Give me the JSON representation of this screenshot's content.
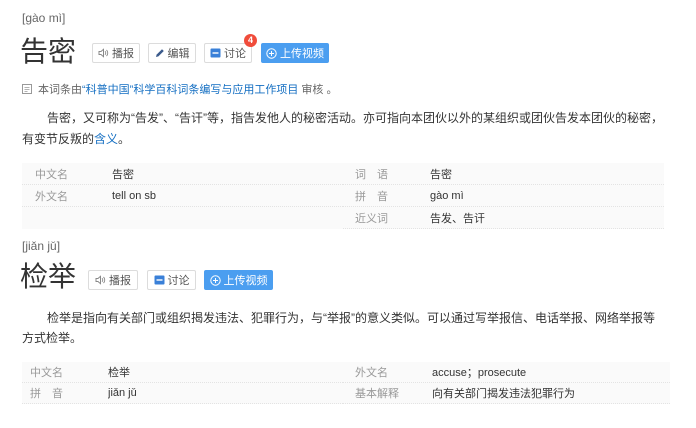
{
  "entries": [
    {
      "pinyin": "[gào mì]",
      "title": "告密",
      "actions": {
        "broadcast_label": "播报",
        "edit_label": "编辑",
        "discuss_label": "讨论",
        "discuss_count": "4",
        "upload_video_label": "上传视频"
      },
      "review_notice": {
        "prefix": "本词条由",
        "link": "“科普中国”科学百科词条编写与应用工作项目",
        "suffix": " 审核 。"
      },
      "summary": {
        "text_before_link": "告密，又可称为“告发”、“告讦”等，指告发他人的秘密活动。亦可指向本团伙以外的某组织或团伙告发本团伙的秘密，有变节反叛的",
        "link": "含义",
        "text_after_link": "。"
      },
      "basic_info": {
        "left": [
          {
            "label": "中文名",
            "value": "告密"
          },
          {
            "label": "外文名",
            "value": "tell on sb"
          }
        ],
        "right": [
          {
            "label": "词　语",
            "value": "告密"
          },
          {
            "label": "拼　音",
            "value": "gào mì"
          },
          {
            "label": "近义词",
            "value": "告发、告讦"
          }
        ]
      }
    },
    {
      "pinyin": "[jiǎn jǔ]",
      "title": "检举",
      "actions": {
        "broadcast_label": "播报",
        "discuss_label": "讨论",
        "upload_video_label": "上传视频"
      },
      "summary": {
        "text": "检举是指向有关部门或组织揭发违法、犯罪行为，与“举报”的意义类似。可以通过写举报信、电话举报、网络举报等方式检举。"
      },
      "basic_info": {
        "left": [
          {
            "label": "中文名",
            "value": "检举"
          },
          {
            "label": "拼　音",
            "value": "jiǎn jǔ"
          }
        ],
        "right": [
          {
            "label": "外文名",
            "value": "accuse；prosecute"
          },
          {
            "label": "基本解释",
            "value": "向有关部门揭发违法犯罪行为"
          }
        ]
      }
    }
  ],
  "icons": {
    "broadcast": "speaker-icon",
    "edit": "pencil-icon",
    "discuss": "discussion-icon",
    "upload_video": "plus-circle-icon",
    "review_notice": "document-icon"
  },
  "colors": {
    "link": "#136ec2",
    "upload_button": "#4b9ef0",
    "badge": "#f04c3b",
    "discuss_icon": "#3a80d8",
    "label_text": "#999999",
    "body_text": "#333333"
  }
}
